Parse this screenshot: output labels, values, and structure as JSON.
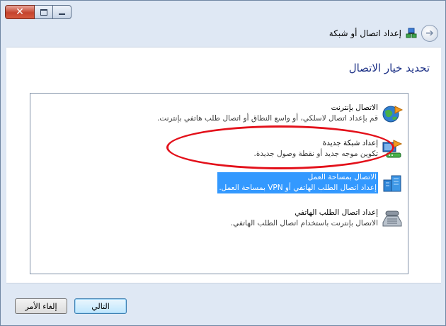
{
  "window": {
    "title": "إعداد اتصال أو شبكة"
  },
  "caption_buttons": {
    "close_glyph": "✕"
  },
  "header": {
    "back_glyph": "➔"
  },
  "main": {
    "instruction": "تحديد خيار الاتصال"
  },
  "options": [
    {
      "title": "الاتصال بإنترنت",
      "description": "قم بإعداد اتصال لاسلكي، أو واسع النطاق أو اتصال طلب هاتفي بإنترنت.",
      "icon": "globe-internet-icon",
      "selected": false
    },
    {
      "title": "إعداد شبكة جديدة",
      "description": "تكوين موجه جديد أو نقطة وصول جديدة.",
      "icon": "router-network-icon",
      "selected": false
    },
    {
      "title": "الاتصال بمساحة العمل",
      "description": "إعداد اتصال الطلب الهاتفي أو VPN بمساحة العمل.",
      "icon": "workplace-buildings-icon",
      "selected": true
    },
    {
      "title": "إعداد اتصال الطلب الهاتفي",
      "description": "الاتصال بإنترنت باستخدام اتصال الطلب الهاتفي.",
      "icon": "telephone-modem-icon",
      "selected": false
    }
  ],
  "footer": {
    "next_label": "التالي",
    "cancel_label": "إلغاء الأمر"
  },
  "colors": {
    "selection": "#3399ff",
    "highlight_ellipse": "#e3101a",
    "instruction_text": "#1e3287"
  }
}
